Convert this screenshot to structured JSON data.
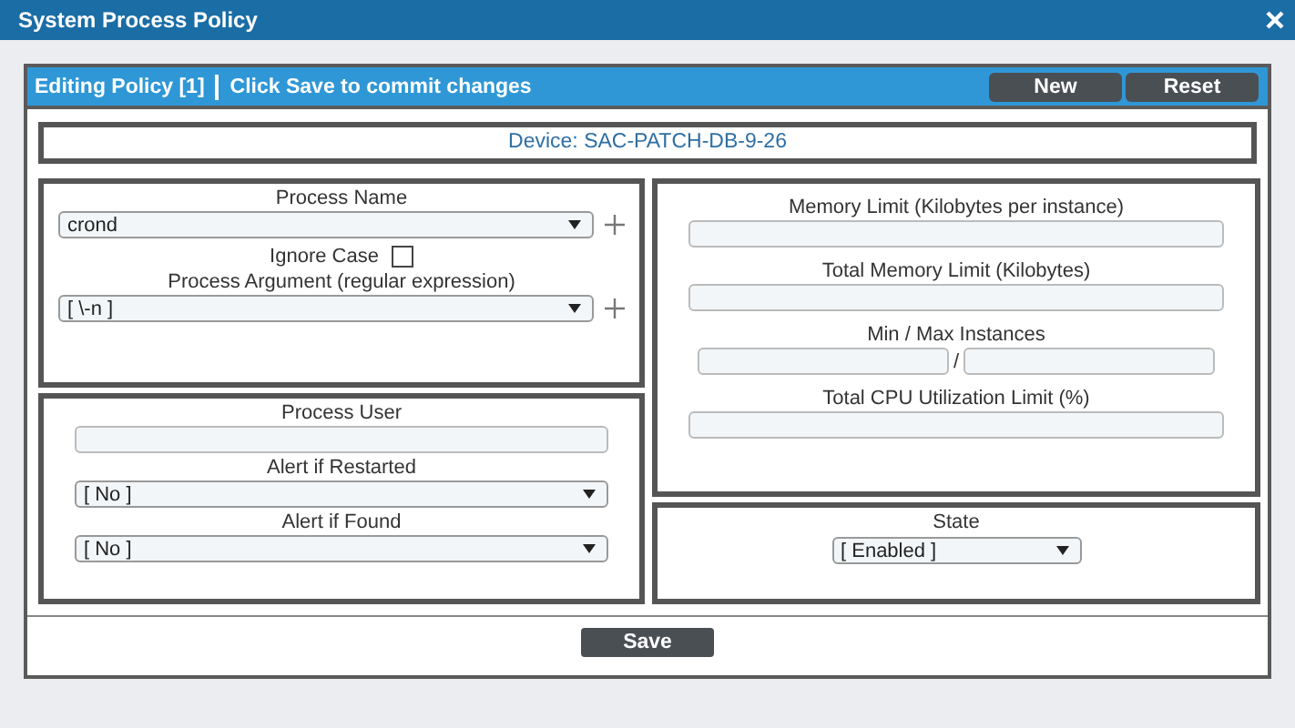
{
  "window": {
    "title": "System Process Policy"
  },
  "header": {
    "title": "Editing Policy [1]",
    "message": "Click Save to commit changes",
    "buttons": [
      "New",
      "Reset"
    ]
  },
  "device": "Device: SAC-PATCH-DB-9-26",
  "panels": [
    {
      "fields": [
        {
          "kind": "select",
          "label": "Process Name",
          "value": "crond",
          "addable": true
        },
        {
          "kind": "checkbox",
          "label": "Ignore Case",
          "checked": false
        },
        {
          "kind": "select",
          "label": "Process Argument (regular expression)",
          "value": "[ \\-n ]",
          "addable": true
        }
      ]
    },
    {
      "fields": [
        {
          "kind": "text",
          "label": "Process User"
        },
        {
          "kind": "select",
          "label": "Alert if Restarted",
          "value": "[ No ]",
          "addable": false
        },
        {
          "kind": "select",
          "label": "Alert if Found",
          "value": "[ No ]",
          "addable": false
        }
      ]
    },
    {
      "fields": [
        {
          "kind": "text",
          "label": "Memory Limit (Kilobytes per instance)"
        },
        {
          "kind": "text",
          "label": "Total Memory Limit (Kilobytes)"
        },
        {
          "kind": "range",
          "label": "Min / Max Instances",
          "separator": "/"
        },
        {
          "kind": "text",
          "label": "Total CPU Utilization Limit (%)"
        }
      ]
    },
    {
      "fields": [
        {
          "kind": "short-select",
          "label": "State",
          "value": "[ Enabled ]"
        }
      ]
    }
  ],
  "footer": {
    "button": "Save"
  }
}
